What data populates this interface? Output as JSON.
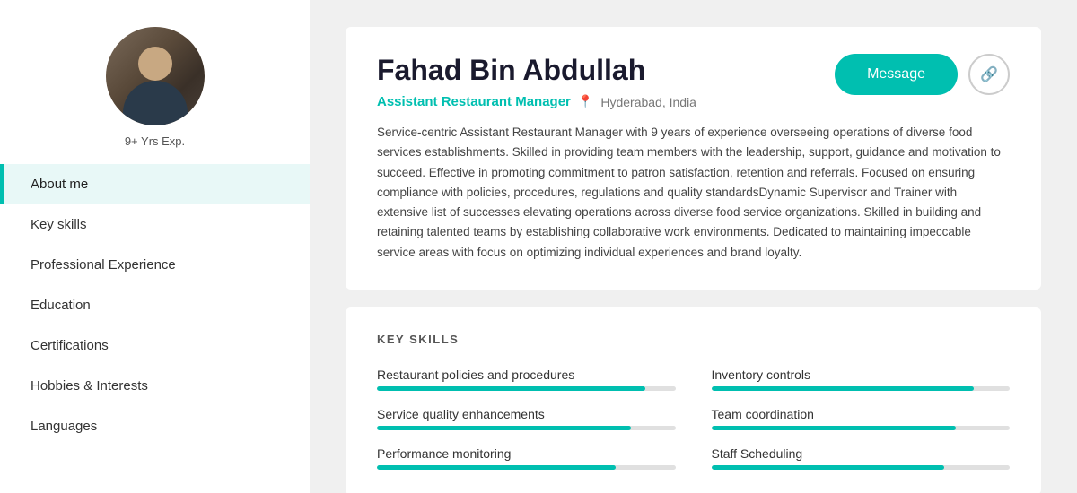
{
  "sidebar": {
    "exp_label": "9+ Yrs Exp.",
    "nav_items": [
      {
        "id": "about-me",
        "label": "About me",
        "active": true
      },
      {
        "id": "key-skills",
        "label": "Key skills",
        "active": false
      },
      {
        "id": "professional-experience",
        "label": "Professional Experience",
        "active": false
      },
      {
        "id": "education",
        "label": "Education",
        "active": false
      },
      {
        "id": "certifications",
        "label": "Certifications",
        "active": false
      },
      {
        "id": "hobbies-interests",
        "label": "Hobbies & Interests",
        "active": false
      },
      {
        "id": "languages",
        "label": "Languages",
        "active": false
      }
    ]
  },
  "profile": {
    "name": "Fahad Bin Abdullah",
    "job_title": "Assistant Restaurant Manager",
    "location": "Hyderabad, India",
    "about": "Service-centric Assistant Restaurant Manager with 9 years of experience overseeing operations of diverse food services establishments. Skilled in providing team members with the leadership, support, guidance and motivation to succeed. Effective in promoting commitment to patron satisfaction, retention and referrals. Focused on ensuring compliance with policies, procedures, regulations and quality standardsDynamic Supervisor and Trainer with extensive list of successes elevating operations across diverse food service organizations. Skilled in building and retaining talented teams by establishing collaborative work environments. Dedicated to maintaining impeccable service areas with focus on optimizing individual experiences and brand loyalty.",
    "message_btn": "Message",
    "share_btn_icon": "share"
  },
  "skills": {
    "heading": "KEY SKILLS",
    "items": [
      {
        "name": "Restaurant policies and procedures",
        "fill": 90
      },
      {
        "name": "Inventory controls",
        "fill": 88
      },
      {
        "name": "Service quality enhancements",
        "fill": 85
      },
      {
        "name": "Team coordination",
        "fill": 82
      },
      {
        "name": "Performance monitoring",
        "fill": 80
      },
      {
        "name": "Staff Scheduling",
        "fill": 78
      }
    ]
  }
}
